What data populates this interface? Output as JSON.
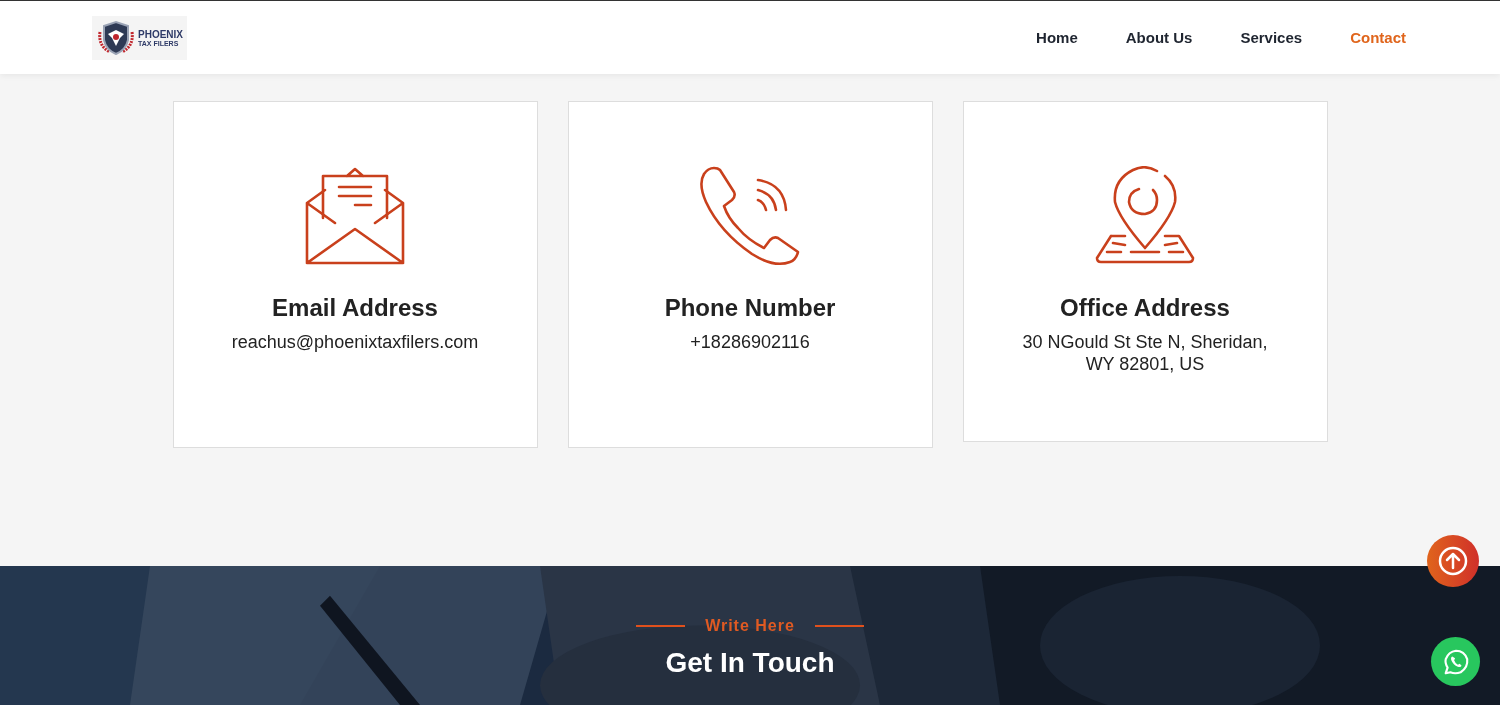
{
  "logo": {
    "name": "PHOENIX",
    "tagline": "TAX FILERS"
  },
  "nav": [
    {
      "label": "Home",
      "selected": false
    },
    {
      "label": "About Us",
      "selected": false
    },
    {
      "label": "Services",
      "selected": false
    },
    {
      "label": "Contact",
      "selected": true
    }
  ],
  "cards": [
    {
      "kind": "email",
      "title": "Email Address",
      "lines": [
        "reachus@phoenixtaxfilers.com"
      ]
    },
    {
      "kind": "phone",
      "title": "Phone Number",
      "lines": [
        "+18286902116"
      ]
    },
    {
      "kind": "location",
      "title": "Office Address",
      "lines": [
        "30 NGould St Ste N, Sheridan,",
        "WY 82801, US"
      ]
    }
  ],
  "contact_section": {
    "kind": "picture",
    "eyebrow": "Write Here",
    "heading": "Get In Touch"
  }
}
